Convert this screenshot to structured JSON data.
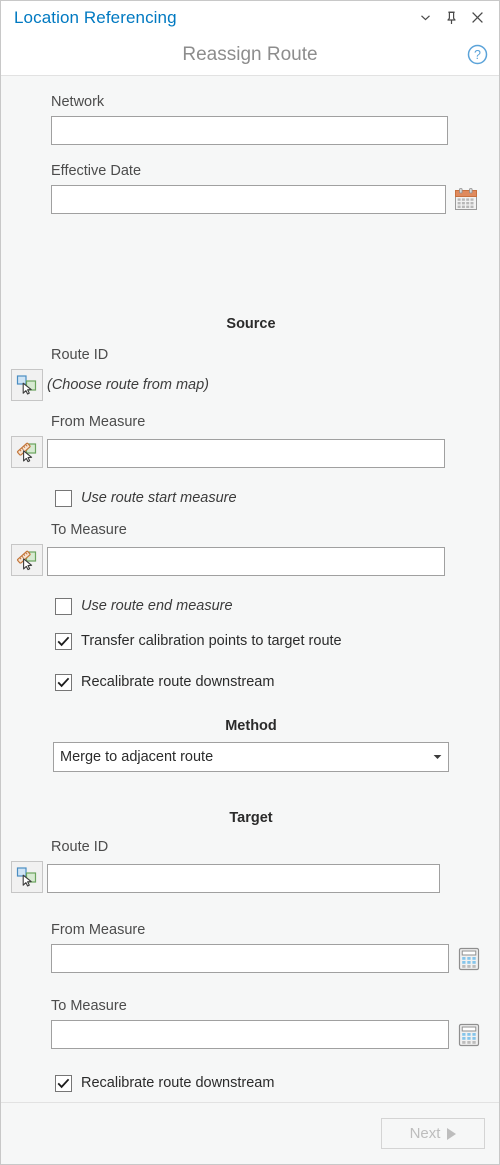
{
  "window": {
    "title": "Location Referencing",
    "subtitle": "Reassign Route",
    "controls": [
      {
        "name": "collapse-chevron",
        "label": "⌄"
      },
      {
        "name": "pin",
        "label": "Pin"
      },
      {
        "name": "close",
        "label": "✕"
      }
    ],
    "help_label": "?"
  },
  "form": {
    "network": {
      "label": "Network",
      "value": "",
      "placeholder": ""
    },
    "effective_date": {
      "label": "Effective Date",
      "value": "",
      "placeholder": "",
      "button_icon": "calendar-icon"
    }
  },
  "source": {
    "heading": "Source",
    "route_id": {
      "label": "Route ID",
      "hint": "(Choose route from map)",
      "tool_icon": "select-route-from-map-icon"
    },
    "from_measure": {
      "label": "From Measure",
      "value": "",
      "placeholder": "",
      "tool_icon": "pick-measure-from-map-icon"
    },
    "use_start": {
      "label": "Use route start measure",
      "checked": false
    },
    "to_measure": {
      "label": "To Measure",
      "value": "",
      "placeholder": "",
      "tool_icon": "pick-measure-from-map-icon"
    },
    "use_end": {
      "label": "Use route end measure",
      "checked": false
    },
    "transfer_calibration": {
      "label": "Transfer calibration points to target route",
      "checked": true
    },
    "recalibrate": {
      "label": "Recalibrate route downstream",
      "checked": true
    }
  },
  "method": {
    "heading": "Method",
    "selected": "Merge to adjacent route",
    "options": [
      "Merge to adjacent route"
    ]
  },
  "target": {
    "heading": "Target",
    "route_id": {
      "label": "Route ID",
      "value": "",
      "placeholder": "",
      "tool_icon": "select-route-from-map-icon"
    },
    "from_measure": {
      "label": "From Measure",
      "value": "",
      "placeholder": "",
      "button_icon": "calculator-icon"
    },
    "to_measure": {
      "label": "To Measure",
      "value": "",
      "placeholder": "",
      "button_icon": "calculator-icon"
    },
    "recalibrate": {
      "label": "Recalibrate route downstream",
      "checked": true
    }
  },
  "footer": {
    "next_label": "Next",
    "next_enabled": false
  },
  "colors": {
    "accent": "#0079c1",
    "pane_bg": "#f6f7f7",
    "field_border": "#a0a0a0",
    "disabled_text": "#bdbdbd"
  }
}
